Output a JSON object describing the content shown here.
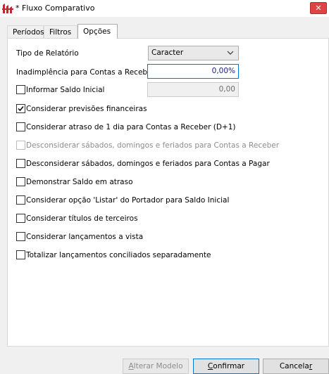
{
  "window": {
    "title": "* Fluxo Comparativo",
    "close_glyph": "✕"
  },
  "tabs": [
    {
      "label": "Períodos",
      "active": false
    },
    {
      "label": "Filtros",
      "active": false
    },
    {
      "label": "Opções",
      "active": true
    }
  ],
  "options": {
    "report_type": {
      "label": "Tipo de Relatório",
      "value": "Caracter"
    },
    "default_rate": {
      "label": "Inadimplência para Contas a Receber",
      "value": "0,00%"
    },
    "initial_balance": {
      "label": "Informar Saldo Inicial",
      "value": "0,00",
      "checked": false
    },
    "checkboxes": [
      {
        "label": "Considerar previsões financeiras",
        "checked": true,
        "enabled": true
      },
      {
        "label": "Considerar atraso de 1 dia para Contas a Receber (D+1)",
        "checked": false,
        "enabled": true
      },
      {
        "label": "Desconsiderar sábados, domingos e feriados para Contas a Receber",
        "checked": false,
        "enabled": false
      },
      {
        "label": "Desconsiderar sábados, domingos e feriados para Contas a Pagar",
        "checked": false,
        "enabled": true
      },
      {
        "label": "Demonstrar Saldo em atraso",
        "checked": false,
        "enabled": true
      },
      {
        "label": "Considerar opção 'Listar' do Portador para Saldo Inicial",
        "checked": false,
        "enabled": true
      },
      {
        "label": "Considerar títulos de terceiros",
        "checked": false,
        "enabled": true
      },
      {
        "label": "Considerar lançamentos a vista",
        "checked": false,
        "enabled": true
      },
      {
        "label": "Totalizar lançamentos conciliados separadamente",
        "checked": false,
        "enabled": true
      }
    ]
  },
  "buttons": {
    "alter_model": {
      "prefix": "A",
      "rest": "lterar Modelo",
      "enabled": false
    },
    "confirm": {
      "prefix": "C",
      "rest": "onfirmar",
      "enabled": true
    },
    "cancel": {
      "prefix": "Cancela",
      "mid": "r",
      "enabled": true
    }
  },
  "icons": {
    "app": "app-logo-icon",
    "chevron": "chevron-down-icon",
    "check": "checkmark-icon"
  },
  "colors": {
    "focus_border": "#0078d7",
    "close_button": "#e04343"
  }
}
